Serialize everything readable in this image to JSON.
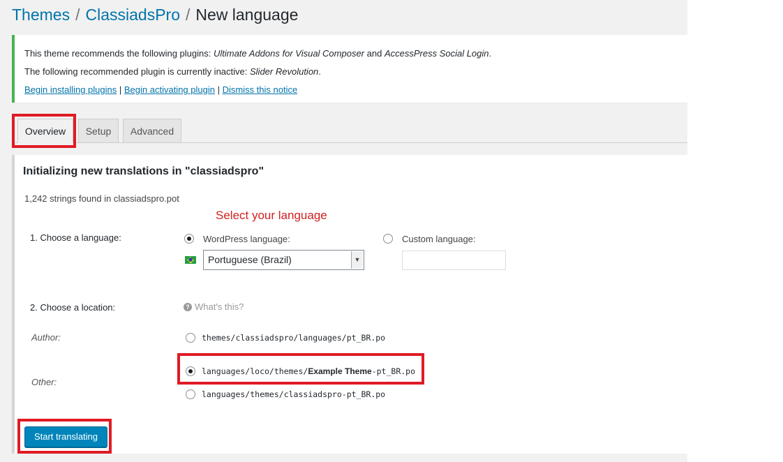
{
  "breadcrumb": {
    "themes": "Themes",
    "separator": "/",
    "theme": "ClassiadsPro",
    "current": "New language"
  },
  "notice": {
    "line1_prefix": "This theme recommends the following plugins: ",
    "plugin1": "Ultimate Addons for Visual Composer",
    "line1_and": " and ",
    "plugin2": "AccessPress Social Login",
    "line1_suffix": ".",
    "line2_prefix": "The following recommended plugin is currently inactive: ",
    "inactive_plugin": "Slider Revolution",
    "line2_suffix": ".",
    "link_install": "Begin installing plugins",
    "link_activate": "Begin activating plugin",
    "link_dismiss": "Dismiss this notice",
    "link_sep": " | "
  },
  "tabs": [
    {
      "label": "Overview",
      "active": true
    },
    {
      "label": "Setup",
      "active": false
    },
    {
      "label": "Advanced",
      "active": false
    }
  ],
  "panel": {
    "title": "Initializing new translations in \"classiadspro\"",
    "strings_found": "1,242 strings found in classiadspro.pot",
    "hint": "Select your language",
    "choose_language_label": "1. Choose a language:",
    "wordpress_language_label": "WordPress language:",
    "custom_language_label": "Custom language:",
    "selected_language": "Portuguese (Brazil)",
    "custom_language_value": "",
    "choose_location_label": "2. Choose a location:",
    "whats_this": "What's this?",
    "author_label": "Author:",
    "other_label": "Other:",
    "location_author": "themes/classiadspro/languages/pt_BR.po",
    "location_other1_prefix": "languages/loco/themes/",
    "location_other1_bold": "Example Theme",
    "location_other1_suffix": "-pt_BR.po",
    "location_other2": "languages/themes/classiadspro-pt_BR.po",
    "start_button": "Start translating"
  },
  "colors": {
    "link": "#0073aa",
    "notice_border": "#46b450",
    "primary_button": "#0085ba",
    "highlight": "#e01b24",
    "hint_text": "#d21f1f"
  },
  "icons": {
    "flag": "brazil-flag-icon",
    "help": "question-circle-icon",
    "select_arrow": "chevron-down-icon"
  }
}
